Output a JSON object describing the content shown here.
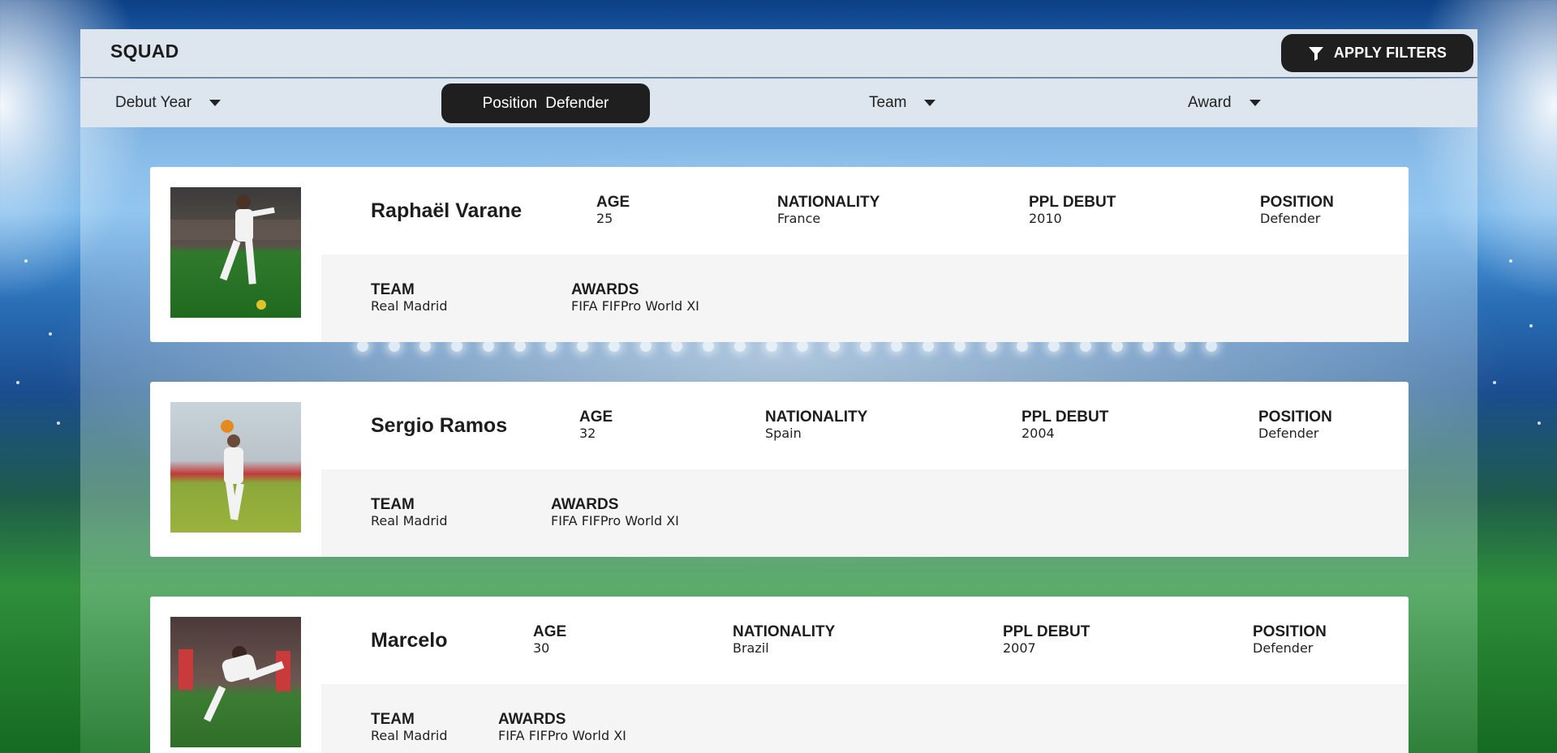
{
  "header": {
    "title": "SQUAD",
    "apply_label": "APPLY FILTERS"
  },
  "filters": {
    "debut_year": "Debut Year",
    "position_label": "Position",
    "position_value": "Defender",
    "team": "Team",
    "award": "Award"
  },
  "field_labels": {
    "age": "AGE",
    "nationality": "NATIONALITY",
    "debut": "PPL DEBUT",
    "position": "POSITION",
    "team": "TEAM",
    "awards": "AWARDS"
  },
  "players": [
    {
      "name": "Raphaël Varane",
      "age": "25",
      "nationality": "France",
      "debut": "2010",
      "position": "Defender",
      "team": "Real Madrid",
      "awards": "FIFA FIFPro World XI"
    },
    {
      "name": "Sergio Ramos",
      "age": "32",
      "nationality": "Spain",
      "debut": "2004",
      "position": "Defender",
      "team": "Real Madrid",
      "awards": "FIFA FIFPro World XI"
    },
    {
      "name": "Marcelo",
      "age": "30",
      "nationality": "Brazil",
      "debut": "2007",
      "position": "Defender",
      "team": "Real Madrid",
      "awards": "FIFA FIFPro World XI"
    }
  ],
  "icons": {
    "apply": "filter-icon",
    "dropdown": "caret-down-icon"
  }
}
